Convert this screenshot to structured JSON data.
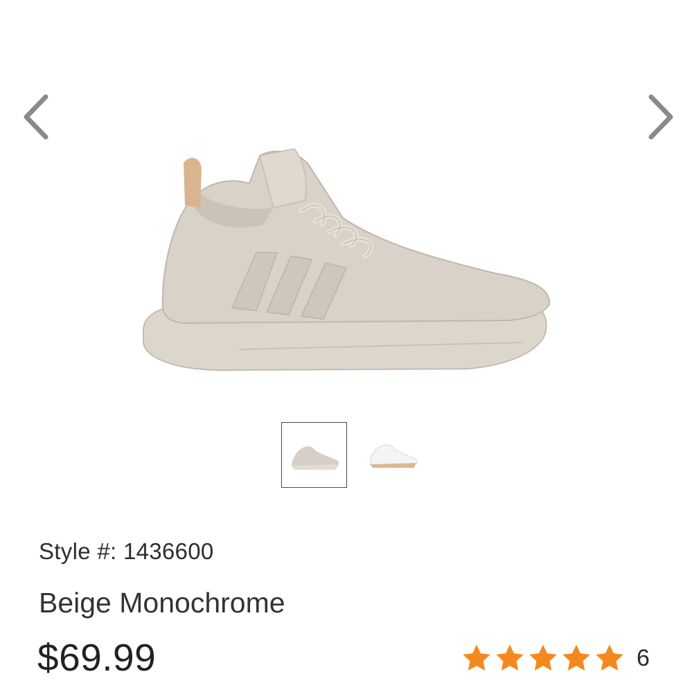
{
  "gallery": {
    "prev_icon": "chevron-left-icon",
    "next_icon": "chevron-right-icon",
    "current_image": 1,
    "image_count": 2,
    "thumbnails": [
      {
        "color": "beige",
        "selected": true
      },
      {
        "color": "white",
        "selected": false
      }
    ]
  },
  "product": {
    "style_label": "Style #:",
    "style_number": "1436600",
    "color_name": "Beige Monochrome",
    "price": "$69.99",
    "rating": {
      "stars": 5,
      "max": 5,
      "review_count": "6",
      "star_color": "#F5891E"
    }
  },
  "colors": {
    "shoe_beige": "#D6CFC6",
    "arrow": "#8a8a8a",
    "text": "#2b2b2b"
  }
}
